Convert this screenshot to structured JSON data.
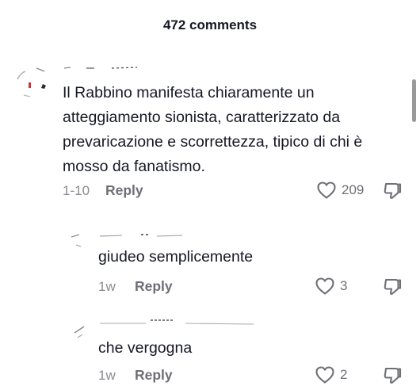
{
  "header": {
    "title": "472 comments"
  },
  "comments": [
    {
      "text": "Il Rabbino manifesta chiaramente un atteggiamento sionista, caratterizzato da prevaricazione e scorrettezza, tipico di chi è mosso da fanatismo.",
      "date": "1-10",
      "reply_label": "Reply",
      "likes": "209",
      "like_icon": "heart-outline-icon",
      "dislike_icon": "thumbs-down-outline-icon"
    }
  ],
  "replies": [
    {
      "text": "giudeo semplicemente",
      "date": "1w",
      "reply_label": "Reply",
      "likes": "3",
      "like_icon": "heart-outline-icon",
      "dislike_icon": "thumbs-down-outline-icon"
    },
    {
      "text": "che vergogna",
      "date": "1w",
      "reply_label": "Reply",
      "likes": "2",
      "like_icon": "heart-outline-icon",
      "dislike_icon": "thumbs-down-outline-icon"
    }
  ],
  "colors": {
    "text": "#161823",
    "muted": "#8a8b91",
    "action": "#6f7076"
  }
}
